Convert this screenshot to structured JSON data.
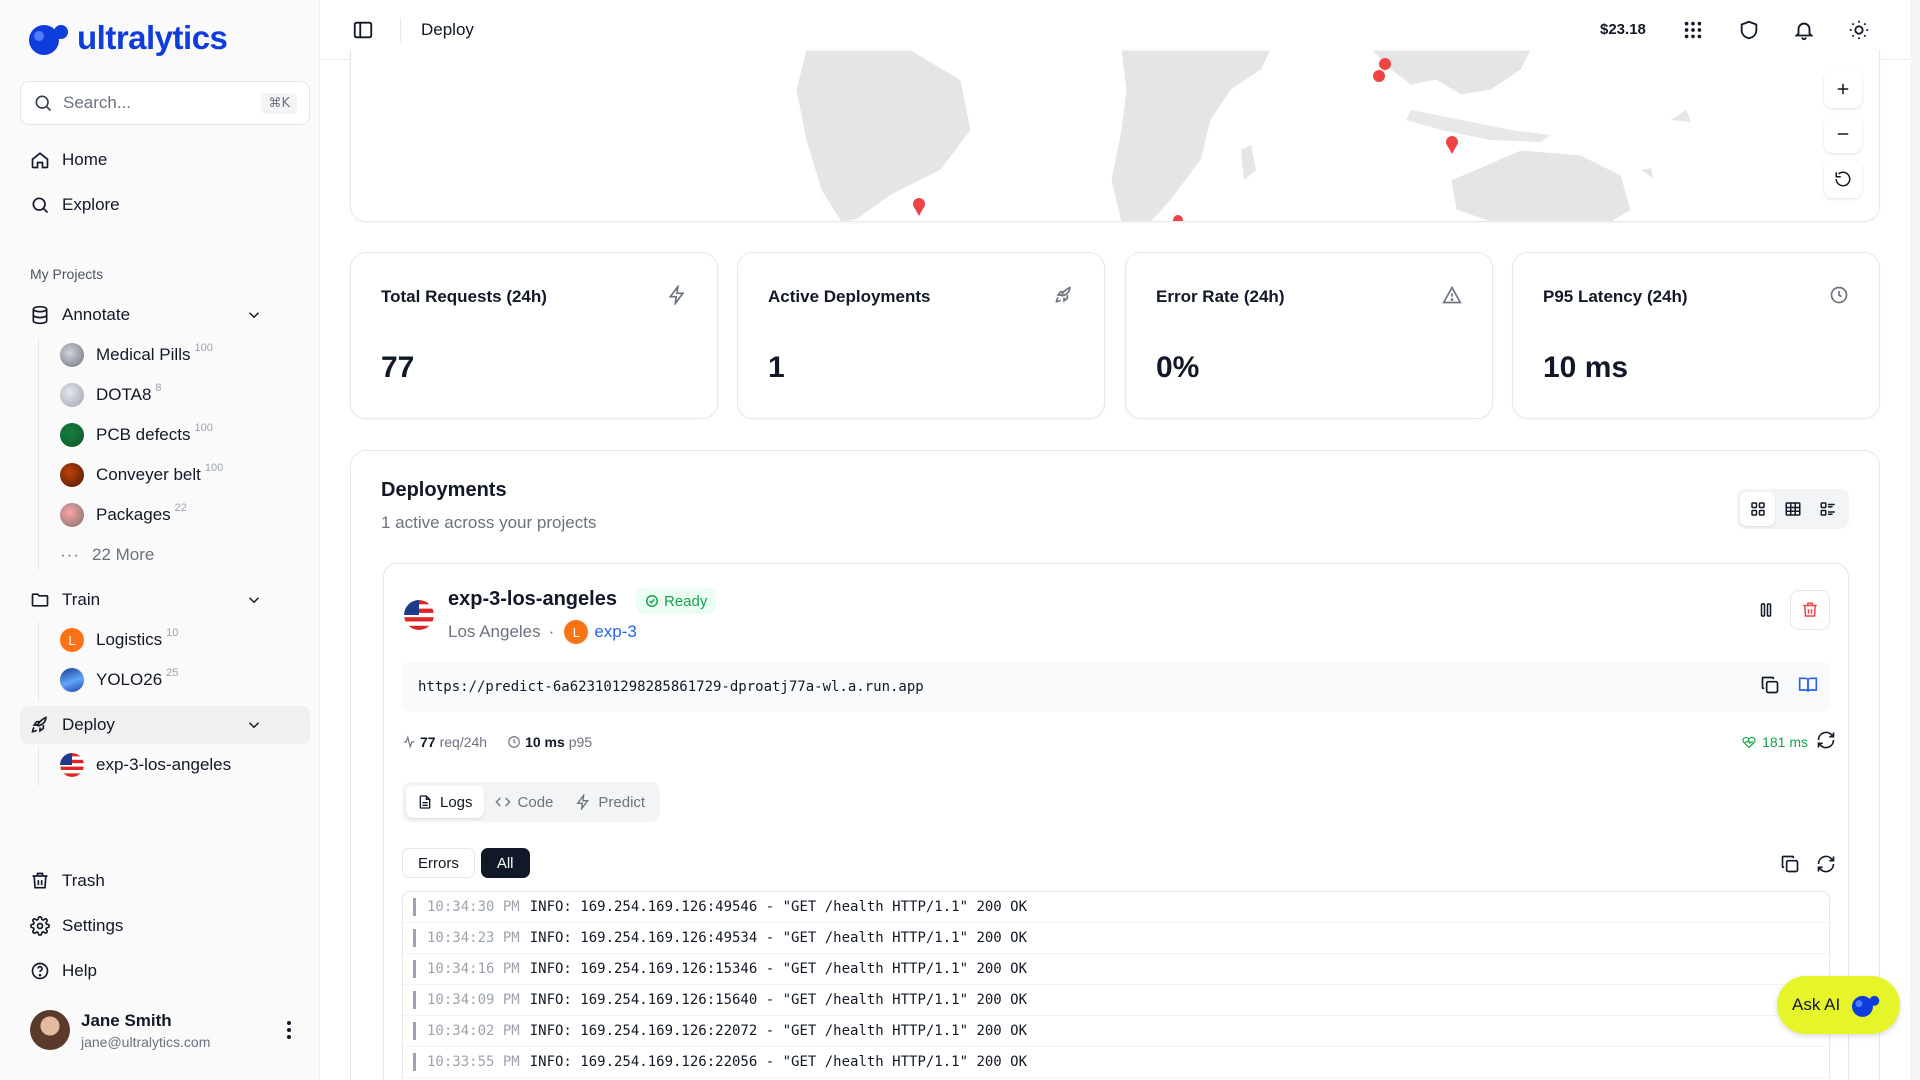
{
  "app": {
    "brand": "ultralytics",
    "page_title": "Deploy",
    "credits": "$23.18"
  },
  "sidebar": {
    "search_placeholder": "Search...",
    "search_shortcut": "⌘K",
    "nav": [
      {
        "label": "Home"
      },
      {
        "label": "Explore"
      }
    ],
    "section_label": "My Projects",
    "annotate": {
      "label": "Annotate",
      "items": [
        {
          "label": "Medical Pills",
          "count": "100"
        },
        {
          "label": "DOTA8",
          "count": "8"
        },
        {
          "label": "PCB defects",
          "count": "100"
        },
        {
          "label": "Conveyer belt",
          "count": "100"
        },
        {
          "label": "Packages",
          "count": "22"
        }
      ],
      "more": "22 More"
    },
    "train": {
      "label": "Train",
      "items": [
        {
          "label": "Logistics",
          "count": "10",
          "chip": "L"
        },
        {
          "label": "YOLO26",
          "count": "25"
        }
      ]
    },
    "deploy": {
      "label": "Deploy",
      "items": [
        {
          "label": "exp-3-los-angeles"
        }
      ]
    },
    "bottom": [
      {
        "label": "Trash"
      },
      {
        "label": "Settings"
      },
      {
        "label": "Help"
      }
    ],
    "user": {
      "name": "Jane Smith",
      "email": "jane@ultralytics.com"
    }
  },
  "stats": [
    {
      "label": "Total Requests (24h)",
      "value": "77",
      "icon": "bolt-icon"
    },
    {
      "label": "Active Deployments",
      "value": "1",
      "icon": "rocket-icon"
    },
    {
      "label": "Error Rate (24h)",
      "value": "0%",
      "icon": "warning-icon"
    },
    {
      "label": "P95 Latency (24h)",
      "value": "10 ms",
      "icon": "clock-icon"
    }
  ],
  "deployments": {
    "title": "Deployments",
    "subtitle": "1 active across your projects",
    "card": {
      "name": "exp-3-los-angeles",
      "status": "Ready",
      "region": "Los Angeles",
      "project_chip": "L",
      "project": "exp-3",
      "url": "https://predict-6a623101298285861729-dproatj77a-wl.a.run.app",
      "requests": "77",
      "requests_unit": "req/24h",
      "latency": "10 ms",
      "latency_unit": "p95",
      "health": "181 ms",
      "tabs": [
        "Logs",
        "Code",
        "Predict"
      ],
      "filters": [
        "Errors",
        "All"
      ],
      "logs": [
        {
          "time": "10:34:30 PM",
          "msg": "INFO: 169.254.169.126:49546 - \"GET /health HTTP/1.1\" 200 OK"
        },
        {
          "time": "10:34:23 PM",
          "msg": "INFO: 169.254.169.126:49534 - \"GET /health HTTP/1.1\" 200 OK"
        },
        {
          "time": "10:34:16 PM",
          "msg": "INFO: 169.254.169.126:15346 - \"GET /health HTTP/1.1\" 200 OK"
        },
        {
          "time": "10:34:09 PM",
          "msg": "INFO: 169.254.169.126:15640 - \"GET /health HTTP/1.1\" 200 OK"
        },
        {
          "time": "10:34:02 PM",
          "msg": "INFO: 169.254.169.126:22072 - \"GET /health HTTP/1.1\" 200 OK"
        },
        {
          "time": "10:33:55 PM",
          "msg": "INFO: 169.254.169.126:22056 - \"GET /health HTTP/1.1\" 200 OK"
        }
      ]
    }
  },
  "ask_ai": "Ask AI",
  "colors": {
    "brand": "#0f3ddb",
    "ready": "#16a34a",
    "danger": "#ef4444",
    "ask_ai_bg": "#e5f52a",
    "marker": "#ef4444"
  }
}
